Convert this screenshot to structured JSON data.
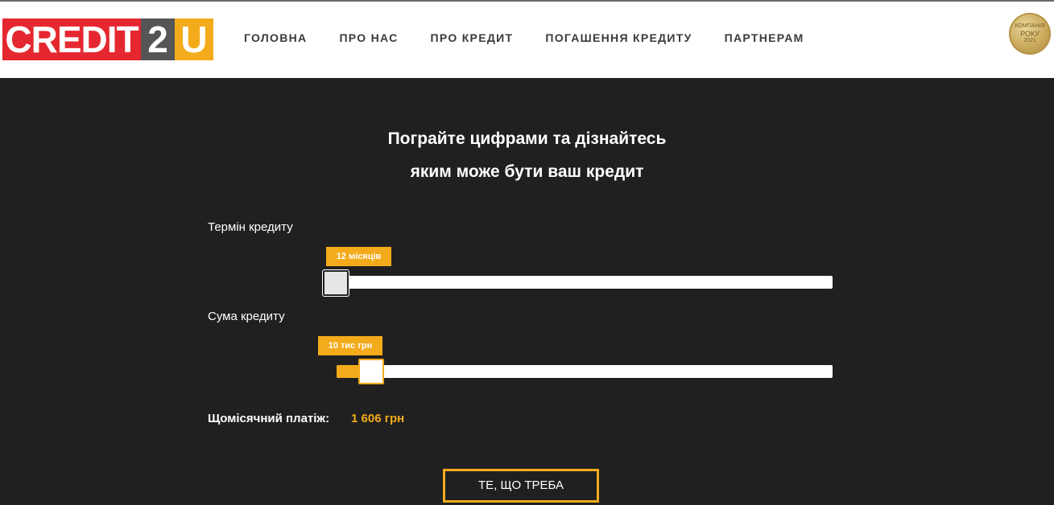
{
  "header": {
    "logo": {
      "part1": "CREDIT",
      "part2": "2",
      "part3": "U"
    },
    "nav": [
      "ГОЛОВНА",
      "ПРО НАС",
      "ПРО КРЕДИТ",
      "ПОГАШЕННЯ КРЕДИТУ",
      "ПАРТНЕРАМ"
    ],
    "award": {
      "line1": "КОМПАНІЯ",
      "line2": "РОКУ",
      "line3": "2021"
    }
  },
  "calculator": {
    "title_line1": "Пограйте цифрами та дізнайтесь",
    "title_line2": "яким може бути ваш кредит",
    "term": {
      "label": "Термін кредиту",
      "value_label": "12 місяців",
      "fraction": 0.0
    },
    "amount": {
      "label": "Сума кредиту",
      "value_label": "10 тис грн",
      "fraction": 0.07
    },
    "payment_label": "Щомісячний платіж:",
    "payment_value": "1 606 грн",
    "cta_label": "ТЕ, ЩО ТРЕБА"
  },
  "colors": {
    "accent": "#f4ab1b",
    "brand_red": "#e52830",
    "brand_gray": "#555557",
    "background": "#202020"
  }
}
